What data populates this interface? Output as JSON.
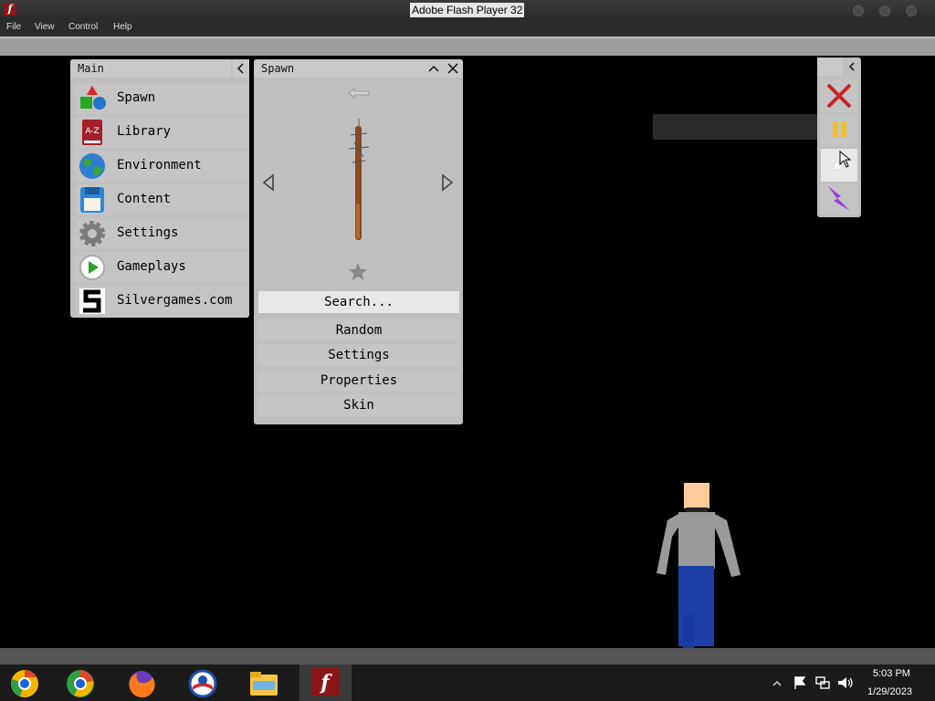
{
  "window": {
    "title": "Adobe Flash Player 32"
  },
  "menu": {
    "items": [
      "File",
      "View",
      "Control",
      "Help"
    ]
  },
  "main_panel": {
    "title": "Main",
    "items": [
      {
        "label": "Spawn",
        "icon": "shapes-icon"
      },
      {
        "label": "Library",
        "icon": "book-icon"
      },
      {
        "label": "Environment",
        "icon": "globe-icon"
      },
      {
        "label": "Content",
        "icon": "floppy-disk-icon"
      },
      {
        "label": "Settings",
        "icon": "gear-icon"
      },
      {
        "label": "Gameplays",
        "icon": "play-icon"
      },
      {
        "label": "Silvergames.com",
        "icon": "silvergames-logo-icon"
      }
    ]
  },
  "spawn_panel": {
    "title": "Spawn",
    "search_label": "Search...",
    "buttons": [
      "Random",
      "Settings",
      "Properties",
      "Skin"
    ],
    "selected_item_icon": "spiked-bat-icon"
  },
  "toolbar": {
    "tools": [
      "close-x-icon",
      "pause-icon",
      "slow-motion-icon",
      "lightning-icon"
    ]
  },
  "taskbar": {
    "apps": [
      "chrome-canary-icon",
      "chrome-icon",
      "firefox-icon",
      "obama-logo-icon",
      "file-explorer-icon",
      "flash-player-icon"
    ],
    "time": "5:03 PM",
    "date": "1/29/2023"
  },
  "colors": {
    "panel": "#bfbfbf",
    "background": "#000000",
    "flash_red": "#8b1414"
  }
}
